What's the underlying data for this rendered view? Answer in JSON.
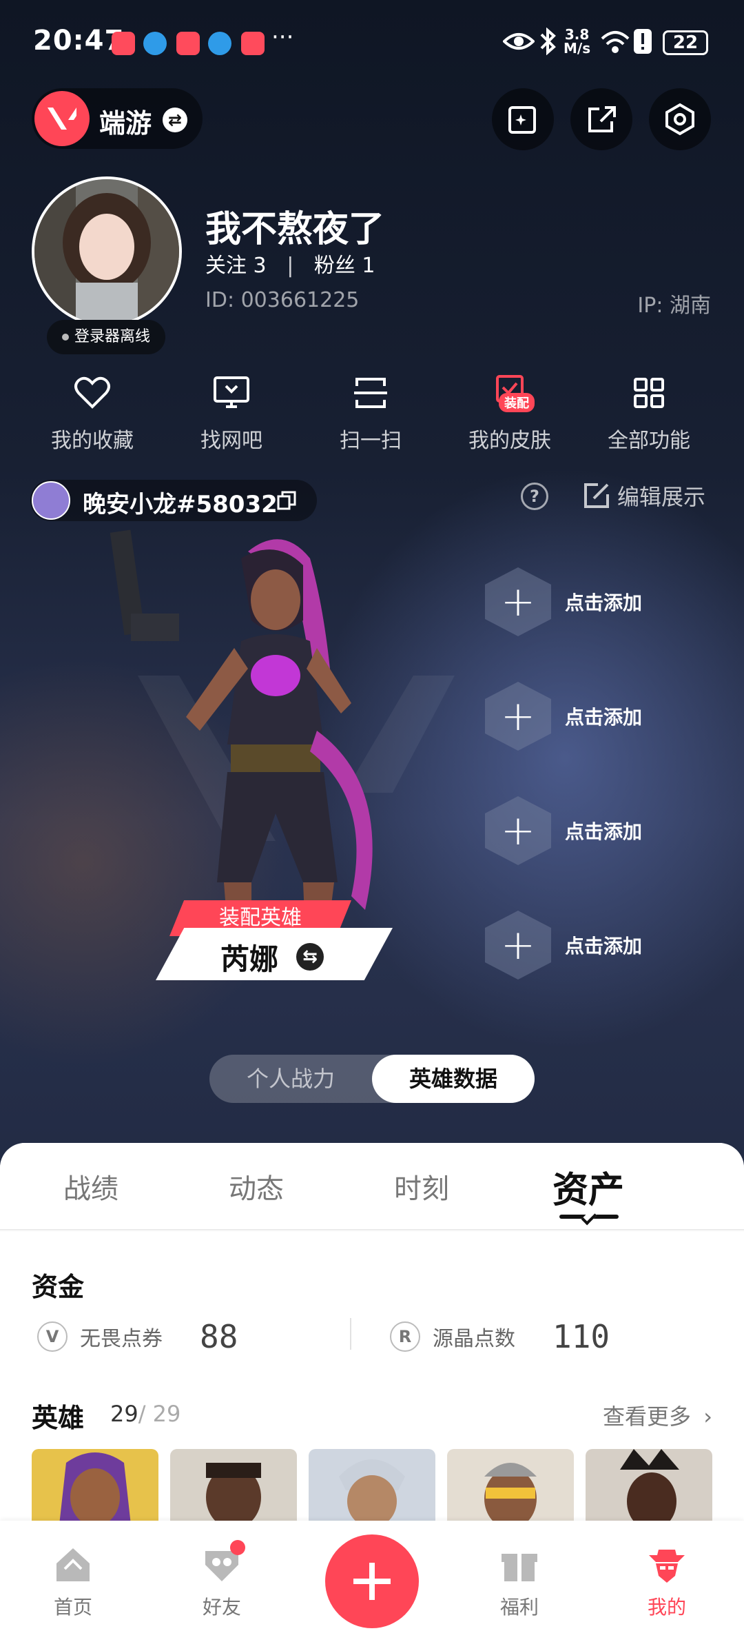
{
  "status": {
    "time": "20:47",
    "more": "···",
    "speed_top": "3.8",
    "speed_unit": "M/s",
    "battery": "22"
  },
  "header": {
    "switch_label": "端游"
  },
  "profile": {
    "nickname": "我不熬夜了",
    "follow_label": "关注",
    "follow_count": "3",
    "fans_label": "粉丝",
    "fans_count": "1",
    "id_text": "ID:  003661225",
    "ip_text": "IP:  湖南",
    "offline_label": "登录器离线"
  },
  "quick_actions": [
    {
      "label": "我的收藏",
      "icon": "heart-icon"
    },
    {
      "label": "找网吧",
      "icon": "monitor-icon"
    },
    {
      "label": "扫一扫",
      "icon": "scan-icon"
    },
    {
      "label": "我的皮肤",
      "icon": "skin-icon",
      "badge": "装配"
    },
    {
      "label": "全部功能",
      "icon": "grid-icon"
    }
  ],
  "game_account": {
    "name": "晚安小龙#58032",
    "edit_label": "编辑展示",
    "help": "?"
  },
  "slots": {
    "add_label": "点击添加",
    "add_symbol": "+"
  },
  "hero": {
    "equip_label": "装配英雄",
    "name": "芮娜",
    "swap": "⇆"
  },
  "toggle": {
    "left": "个人战力",
    "right": "英雄数据"
  },
  "tabs": [
    "战绩",
    "动态",
    "时刻",
    "资产"
  ],
  "assets": {
    "title": "资金",
    "currencies": [
      {
        "icon": "V",
        "label": "无畏点券",
        "value": "88"
      },
      {
        "icon": "R",
        "label": "源晶点数",
        "value": "110"
      }
    ]
  },
  "heroes": {
    "title": "英雄",
    "owned": "29",
    "total": "/ 29",
    "see_more": "查看更多"
  },
  "bottom_nav": [
    {
      "label": "首页",
      "icon": "home-icon"
    },
    {
      "label": "好友",
      "icon": "friends-icon"
    },
    {
      "label": "福利",
      "icon": "gift-icon"
    },
    {
      "label": "我的",
      "icon": "profile-icon"
    }
  ],
  "colors": {
    "accent": "#ff4657",
    "background": "#141a2a",
    "sheet": "#ffffff"
  }
}
